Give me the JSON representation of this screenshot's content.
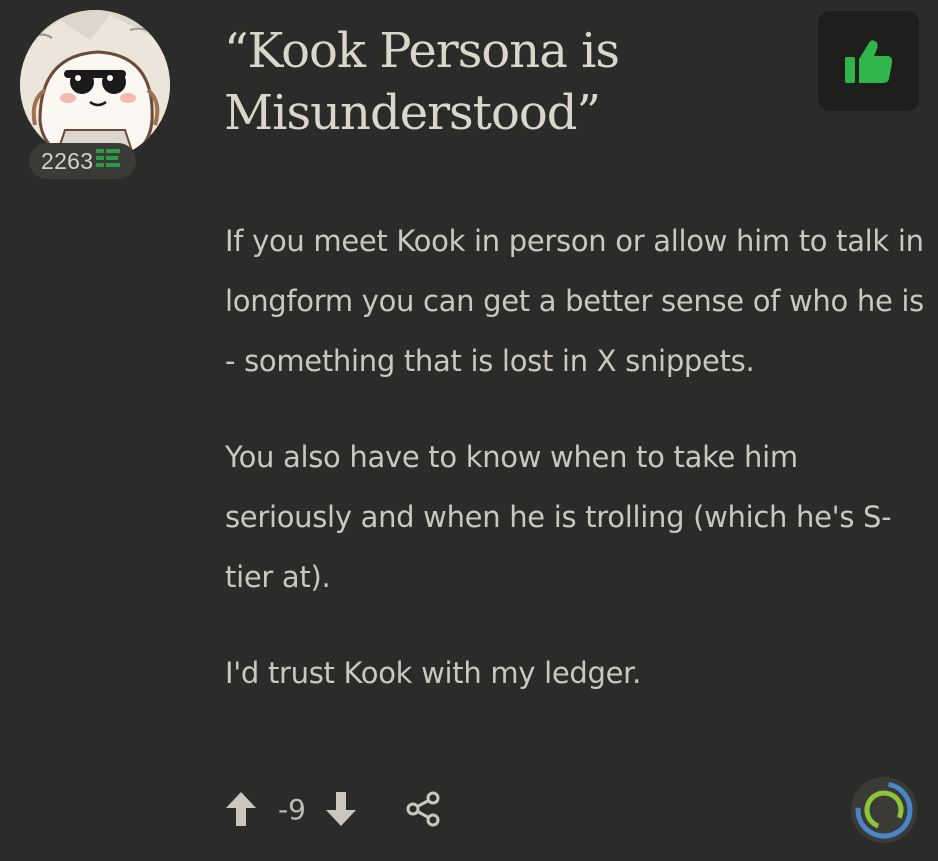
{
  "post": {
    "title": "“Kook Persona is Misunderstood”",
    "paragraphs": [
      "If you meet Kook in person or allow him to talk in longform you can get a better sense of who he is - something that is lost in X snippets.",
      "You also have to know when to take him seriously and when he is trolling (which he's S-tier at).",
      "I'd trust Kook with my ledger."
    ]
  },
  "author": {
    "score": "2263",
    "avatar_icon": "bread-with-sunglasses-avatar",
    "rank_icon": "rank-bars-icon"
  },
  "actions": {
    "vote_count": "-9",
    "upvote_icon": "arrow-up-icon",
    "downvote_icon": "arrow-down-icon",
    "share_icon": "share-icon",
    "like_icon": "thumbs-up-icon"
  },
  "colors": {
    "background": "#2b2b29",
    "like_green": "#2fb54a",
    "rank_green": "#2e9b48",
    "ring_blue": "#4a86c5",
    "ring_green": "#8fc43a"
  }
}
